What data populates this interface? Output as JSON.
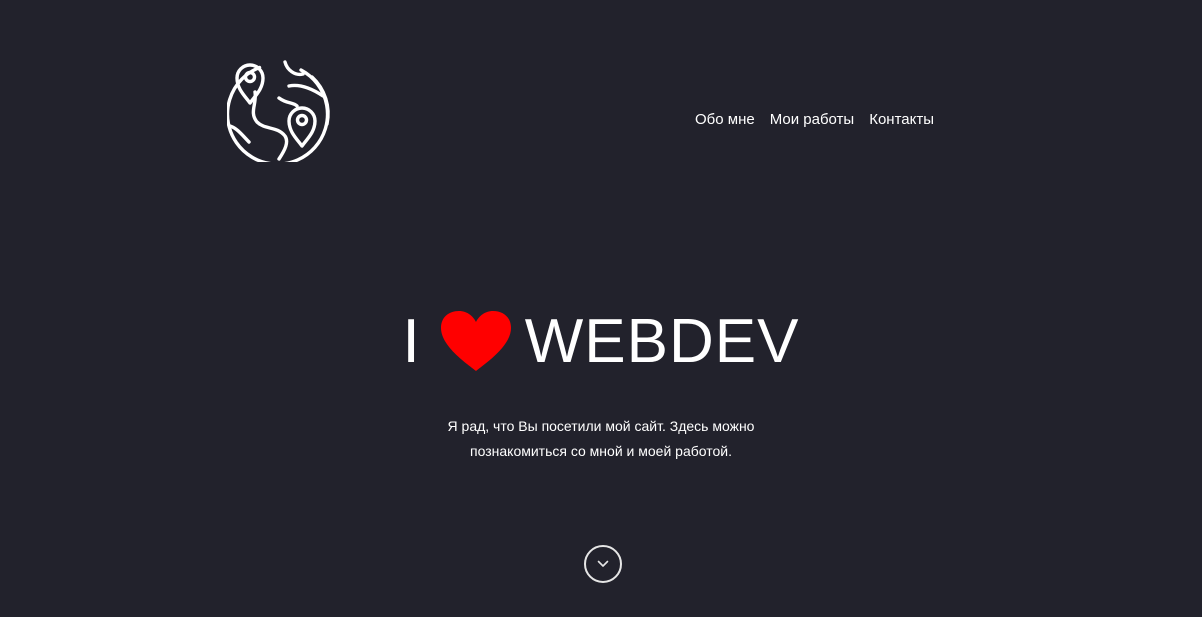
{
  "header": {
    "logo_icon": "globe-with-map-pins-icon",
    "nav": [
      {
        "label": "Обо мне"
      },
      {
        "label": "Мои работы"
      },
      {
        "label": "Контакты"
      }
    ]
  },
  "hero": {
    "title_prefix": "I",
    "title_icon": "heart-icon",
    "title_suffix": "WEBDEV",
    "text_line1": "Я рад, что Вы посетили мой сайт. Здесь можно",
    "text_line2": "познакомиться со мной и моей работой."
  },
  "scroll_down": {
    "icon": "chevron-down-icon"
  },
  "colors": {
    "background": "#22222c",
    "text": "#ffffff",
    "heart": "#ff0000"
  }
}
